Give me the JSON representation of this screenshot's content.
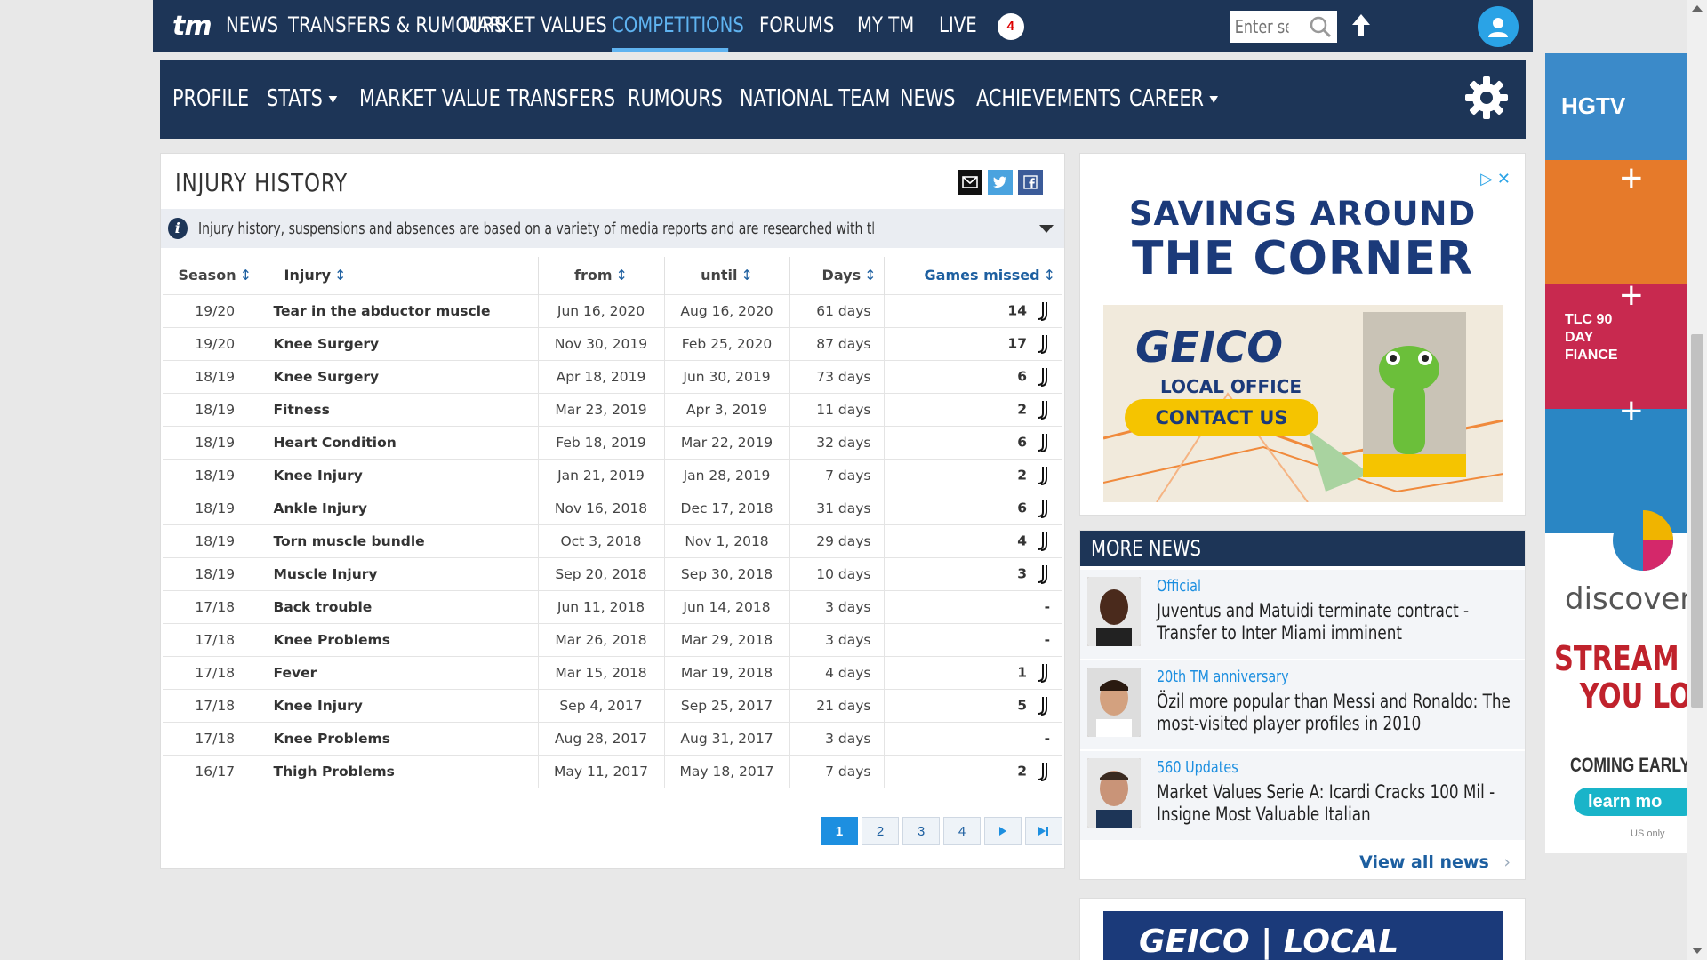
{
  "top_nav": {
    "logo": "tm",
    "items": [
      "NEWS",
      "TRANSFERS & RUMOURS",
      "MARKET VALUES",
      "COMPETITIONS",
      "FORUMS",
      "MY TM",
      "LIVE"
    ],
    "active": "COMPETITIONS",
    "live_count": "4",
    "search_placeholder": "Enter sear"
  },
  "sub_nav": {
    "items": [
      "PROFILE",
      "STATS",
      "MARKET VALUE",
      "TRANSFERS",
      "RUMOURS",
      "NATIONAL TEAM",
      "NEWS",
      "ACHIEVEMENTS",
      "CAREER"
    ]
  },
  "injury": {
    "title": "INJURY HISTORY",
    "info": "Injury history, suspensions and absences are based on a variety of media reports and are researched with the greatest of care. If you should n...",
    "columns": [
      "Season",
      "Injury",
      "from",
      "until",
      "Days",
      "Games missed"
    ],
    "rows": [
      {
        "season": "19/20",
        "injury": "Tear in the abductor muscle",
        "from": "Jun 16, 2020",
        "until": "Aug 16, 2020",
        "days": "61 days",
        "games": "14"
      },
      {
        "season": "19/20",
        "injury": "Knee Surgery",
        "from": "Nov 30, 2019",
        "until": "Feb 25, 2020",
        "days": "87 days",
        "games": "17"
      },
      {
        "season": "18/19",
        "injury": "Knee Surgery",
        "from": "Apr 18, 2019",
        "until": "Jun 30, 2019",
        "days": "73 days",
        "games": "6"
      },
      {
        "season": "18/19",
        "injury": "Fitness",
        "from": "Mar 23, 2019",
        "until": "Apr 3, 2019",
        "days": "11 days",
        "games": "2"
      },
      {
        "season": "18/19",
        "injury": "Heart Condition",
        "from": "Feb 18, 2019",
        "until": "Mar 22, 2019",
        "days": "32 days",
        "games": "6"
      },
      {
        "season": "18/19",
        "injury": "Knee Injury",
        "from": "Jan 21, 2019",
        "until": "Jan 28, 2019",
        "days": "7 days",
        "games": "2"
      },
      {
        "season": "18/19",
        "injury": "Ankle Injury",
        "from": "Nov 16, 2018",
        "until": "Dec 17, 2018",
        "days": "31 days",
        "games": "6"
      },
      {
        "season": "18/19",
        "injury": "Torn muscle bundle",
        "from": "Oct 3, 2018",
        "until": "Nov 1, 2018",
        "days": "29 days",
        "games": "4"
      },
      {
        "season": "18/19",
        "injury": "Muscle Injury",
        "from": "Sep 20, 2018",
        "until": "Sep 30, 2018",
        "days": "10 days",
        "games": "3"
      },
      {
        "season": "17/18",
        "injury": "Back trouble",
        "from": "Jun 11, 2018",
        "until": "Jun 14, 2018",
        "days": "3 days",
        "games": "-"
      },
      {
        "season": "17/18",
        "injury": "Knee Problems",
        "from": "Mar 26, 2018",
        "until": "Mar 29, 2018",
        "days": "3 days",
        "games": "-"
      },
      {
        "season": "17/18",
        "injury": "Fever",
        "from": "Mar 15, 2018",
        "until": "Mar 19, 2018",
        "days": "4 days",
        "games": "1"
      },
      {
        "season": "17/18",
        "injury": "Knee Injury",
        "from": "Sep 4, 2017",
        "until": "Sep 25, 2017",
        "days": "21 days",
        "games": "5"
      },
      {
        "season": "17/18",
        "injury": "Knee Problems",
        "from": "Aug 28, 2017",
        "until": "Aug 31, 2017",
        "days": "3 days",
        "games": "-"
      },
      {
        "season": "16/17",
        "injury": "Thigh Problems",
        "from": "May 11, 2017",
        "until": "May 18, 2017",
        "days": "7 days",
        "games": "2"
      }
    ],
    "pages": [
      "1",
      "2",
      "3",
      "4"
    ],
    "active_page": "1"
  },
  "ad": {
    "line1": "SAVINGS AROUND",
    "line2": "THE CORNER",
    "brand": "GEICO",
    "local": "LOCAL OFFICE",
    "cta": "CONTACT US"
  },
  "more_news": {
    "title": "MORE NEWS",
    "items": [
      {
        "category": "Official",
        "title": "Juventus and Matuidi terminate contract - Transfer to Inter Miami imminent"
      },
      {
        "category": "20th TM anniversary",
        "title": "Özil more popular than Messi and Ronaldo: The most-visited player profiles in 2010"
      },
      {
        "category": "560 Updates",
        "title": "Market Values Serie A: Icardi Cracks 100 Mil - Insigne Most Valuable Italian"
      }
    ],
    "view_all": "View all news"
  },
  "ad2": {
    "text": "GEICO | LOCAL OFFICE"
  },
  "side_ad": {
    "hgtv": "HGTV",
    "tlc": "TLC 90 DAY FIANCE",
    "discovery": "discover",
    "stream": [
      "STREAM W",
      "YOU LO"
    ],
    "coming": "COMING EARLY",
    "learn": "learn mo",
    "us": "US only"
  },
  "colors": {
    "nav_bg": "#1d3557",
    "accent": "#5fb3f0",
    "link": "#1d5fa0"
  }
}
